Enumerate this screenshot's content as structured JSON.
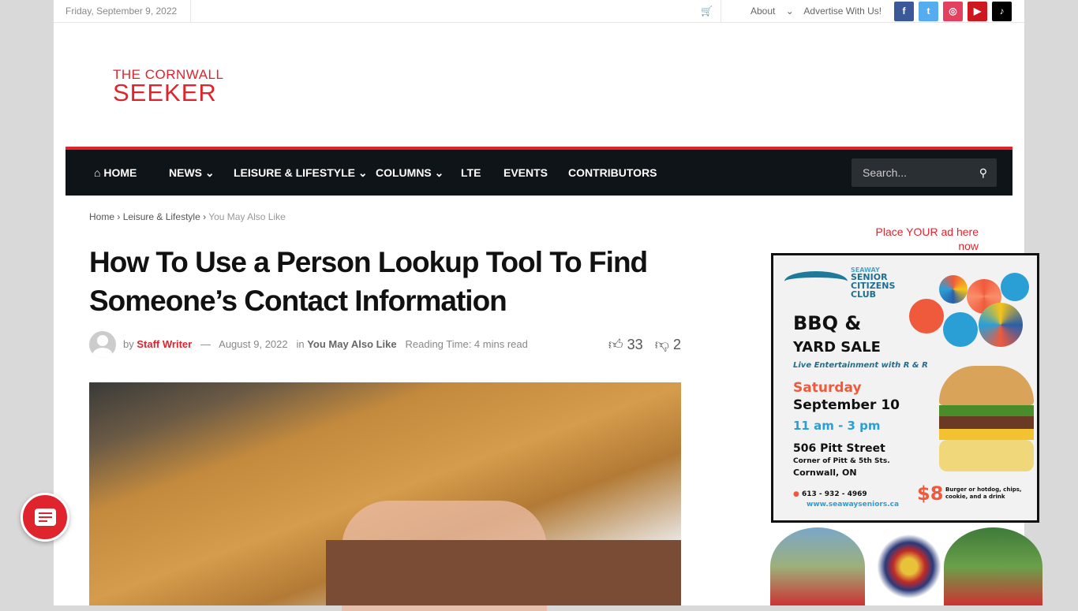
{
  "topbar": {
    "date": "Friday, September 9, 2022",
    "links": [
      "About",
      "Advertise With Us!"
    ],
    "social": [
      {
        "name": "facebook",
        "glyph": "f",
        "color": "#3b5998"
      },
      {
        "name": "twitter",
        "glyph": "t",
        "color": "#55acee"
      },
      {
        "name": "instagram",
        "glyph": "◎",
        "color": "#e4405f"
      },
      {
        "name": "youtube",
        "glyph": "▶",
        "color": "#cc181e"
      },
      {
        "name": "tiktok",
        "glyph": "♪",
        "color": "#000000"
      }
    ]
  },
  "logo": {
    "line1": "THE CORNWALL",
    "line2": "SEEKER"
  },
  "nav": {
    "items": [
      "HOME",
      "NEWS",
      "LEISURE & LIFESTYLE",
      "COLUMNS",
      "LTE",
      "EVENTS",
      "CONTRIBUTORS"
    ],
    "search_placeholder": "Search..."
  },
  "breadcrumb": [
    "Home",
    "Leisure & Lifestyle",
    "You May Also Like"
  ],
  "article": {
    "title": "How To Use a Person Lookup Tool To Find Someone’s Contact Information",
    "by": "by",
    "author": "Staff Writer",
    "dash": "—",
    "date": "August 9, 2022",
    "in": "in",
    "category": "You May Also Like",
    "reading_time": "Reading Time: 4 mins read",
    "likes": "33",
    "dislikes": "2"
  },
  "sidebar": {
    "ad_link": "Place YOUR ad here now",
    "ad": {
      "org1": "SEAWAY",
      "org2": "SENIOR",
      "org3": "CITIZENS",
      "org4": "CLUB",
      "h1": "BBQ &",
      "h2": "YARD SALE",
      "live": "Live Entertainment with R & R",
      "day": "Saturday",
      "date": "September 10",
      "time": "11 am - 3 pm",
      "address": "506 Pitt Street",
      "corner": "Corner of Pitt & 5th  Sts.",
      "city": "Cornwall, ON",
      "phone": "613 - 932 - 4969",
      "web": "www.seawayseniors.ca",
      "price": "$8",
      "price_desc": "Burger or hotdog, chips, cookie, and a drink"
    }
  },
  "colors": {
    "accent": "#e0242e",
    "nav_bg": "#0f1419"
  }
}
